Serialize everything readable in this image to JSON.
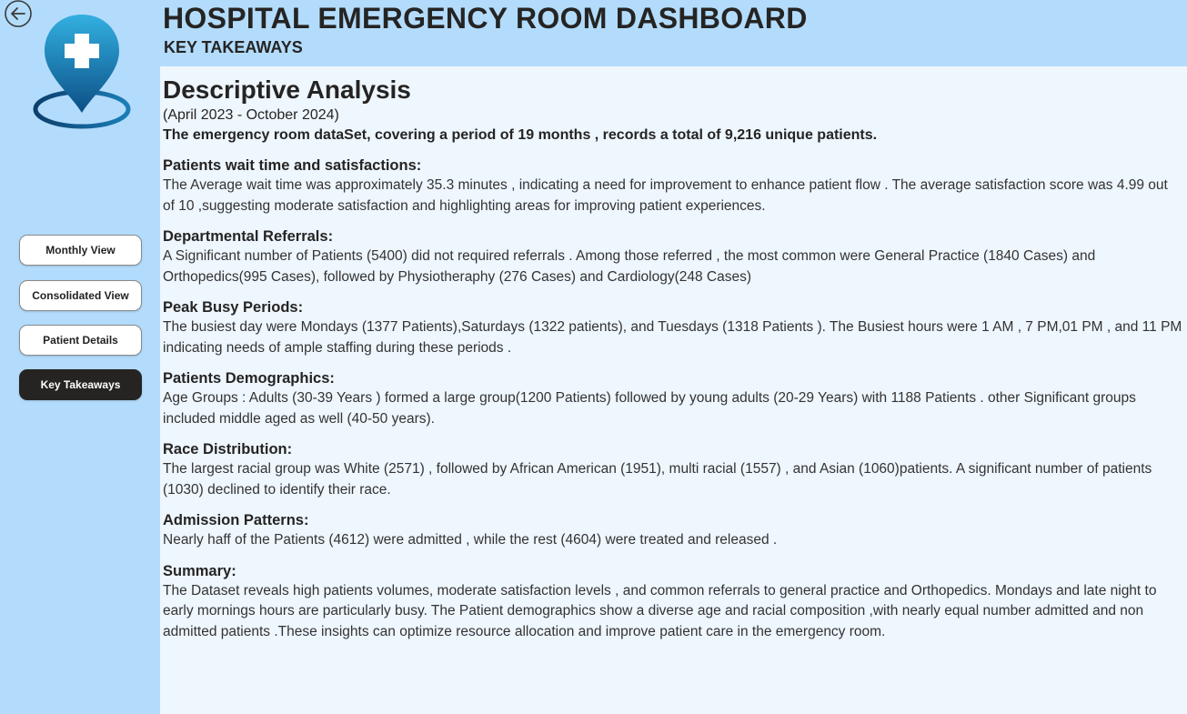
{
  "header": {
    "title": "HOSPITAL EMERGENCY ROOM DASHBOARD",
    "subtitle": "KEY TAKEAWAYS"
  },
  "sidebar": {
    "back_icon": "arrow-left-circle-icon",
    "logo_icon": "medical-location-pin-icon",
    "buttons": [
      {
        "label": "Monthly View",
        "active": false
      },
      {
        "label": "Consolidated View",
        "active": false
      },
      {
        "label": "Patient Details",
        "active": false
      },
      {
        "label": "Key Takeaways",
        "active": true
      }
    ]
  },
  "main": {
    "title": "Descriptive Analysis",
    "period": "(April 2023 - October 2024)",
    "lead": "The emergency room dataSet, covering  a period  of 19  months , records  a total of 9,216 unique patients.",
    "sections": [
      {
        "heading": "Patients wait time and satisfactions:",
        "text": "The Average wait time  was approximately  35.3 minutes , indicating a need for improvement to enhance patient flow . The average satisfaction score was  4.99 out of 10 ,suggesting moderate satisfaction and highlighting areas for improving patient experiences."
      },
      {
        "heading": "Departmental Referrals:",
        "text": "A Significant number of Patients (5400) did not required referrals . Among those referred , the most common were  General Practice  (1840 Cases) and Orthopedics(995 Cases), followed by Physiotheraphy  (276 Cases) and Cardiology(248 Cases)"
      },
      {
        "heading": "Peak Busy Periods:",
        "text": "The busiest day were Mondays (1377 Patients),Saturdays (1322 patients), and Tuesdays (1318 Patients ). The Busiest hours were 1 AM , 7 PM,01 PM , and 11 PM indicating  needs of ample staffing during these periods ."
      },
      {
        "heading": "Patients Demographics:",
        "text": "Age Groups : Adults (30-39 Years ) formed a large group(1200 Patients) followed by young adults (20-29 Years) with 1188 Patients . other Significant groups included middle aged as well (40-50 years)."
      },
      {
        "heading": "Race Distribution:",
        "text": "The largest racial group was White (2571) , followed by African American (1951), multi racial (1557) , and Asian (1060)patients. A significant number of patients (1030) declined to identify their race."
      },
      {
        "heading": "Admission Patterns:",
        "text": "Nearly haff of the Patients (4612) were admitted , while the rest (4604) were treated and released ."
      },
      {
        "heading": "Summary:",
        "text": "The Dataset reveals high patients volumes, moderate satisfaction levels , and common referrals to general practice and Orthopedics. Mondays and late night to early mornings hours are particularly busy. The Patient demographics show a diverse age and racial composition ,with nearly equal number admitted and non admitted patients .These insights can optimize resource allocation and improve patient care in the emergency room."
      }
    ]
  },
  "colors": {
    "sidebar_bg": "#b3dcfc",
    "main_bg": "#eef6fe",
    "active_button": "#252423",
    "logo_gradient_top": "#2ea3d8",
    "logo_gradient_bottom": "#0b4f86"
  }
}
